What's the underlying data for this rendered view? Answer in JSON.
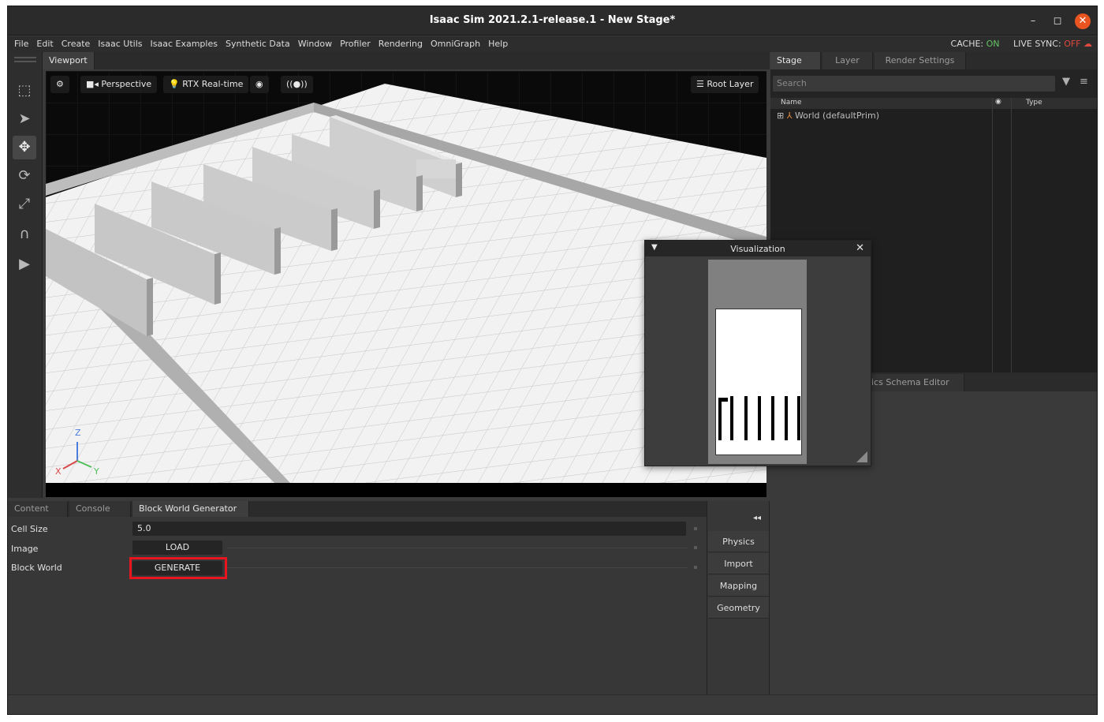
{
  "window": {
    "title": "Isaac Sim 2021.2.1-release.1 - New Stage*",
    "minimize_glyph": "–",
    "maximize_glyph": "◻",
    "close_glyph": "✕"
  },
  "menu": {
    "items": [
      "File",
      "Edit",
      "Create",
      "Isaac Utils",
      "Isaac Examples",
      "Synthetic Data",
      "Window",
      "Profiler",
      "Rendering",
      "OmniGraph",
      "Help"
    ],
    "cache_label": "CACHE:",
    "cache_value": "ON",
    "live_sync_label": "LIVE SYNC:",
    "live_sync_value": "OFF"
  },
  "toolbar": {
    "tools": [
      "select-mode-icon",
      "arrow-cursor-icon",
      "move-icon",
      "rotate-icon",
      "scale-icon",
      "snap-magnet-icon",
      "play-icon"
    ]
  },
  "viewport": {
    "tab_label": "Viewport",
    "camera_label": "Perspective",
    "render_label": "RTX Real-time",
    "root_layer_label": "Root Layer",
    "axis_x": "X",
    "axis_y": "Y",
    "axis_z": "Z"
  },
  "stage": {
    "tabs": [
      "Stage",
      "Layer",
      "Render Settings"
    ],
    "search_placeholder": "Search",
    "columns": {
      "name": "Name",
      "type": "Type"
    },
    "tree": [
      {
        "label": "World (defaultPrim)"
      }
    ]
  },
  "lower_right": {
    "tab_label": "ics Schema Editor"
  },
  "bottom": {
    "tabs": [
      "Content",
      "Console",
      "Block World Generator"
    ],
    "rows": {
      "cell_size_label": "Cell Size",
      "cell_size_value": "5.0",
      "image_label": "Image",
      "load_button": "LOAD",
      "block_world_label": "Block World",
      "generate_button": "GENERATE"
    }
  },
  "side_panel": {
    "collapse_glyph": "◂◂",
    "buttons": [
      "Physics",
      "Import",
      "Mapping",
      "Geometry"
    ]
  },
  "visualization": {
    "title": "Visualization",
    "collapse_glyph": "▼",
    "close_glyph": "✕"
  },
  "colors": {
    "accent_on": "#65c466",
    "accent_off": "#e0493e",
    "highlight_box": "#e8141e",
    "close_button": "#e95420"
  }
}
